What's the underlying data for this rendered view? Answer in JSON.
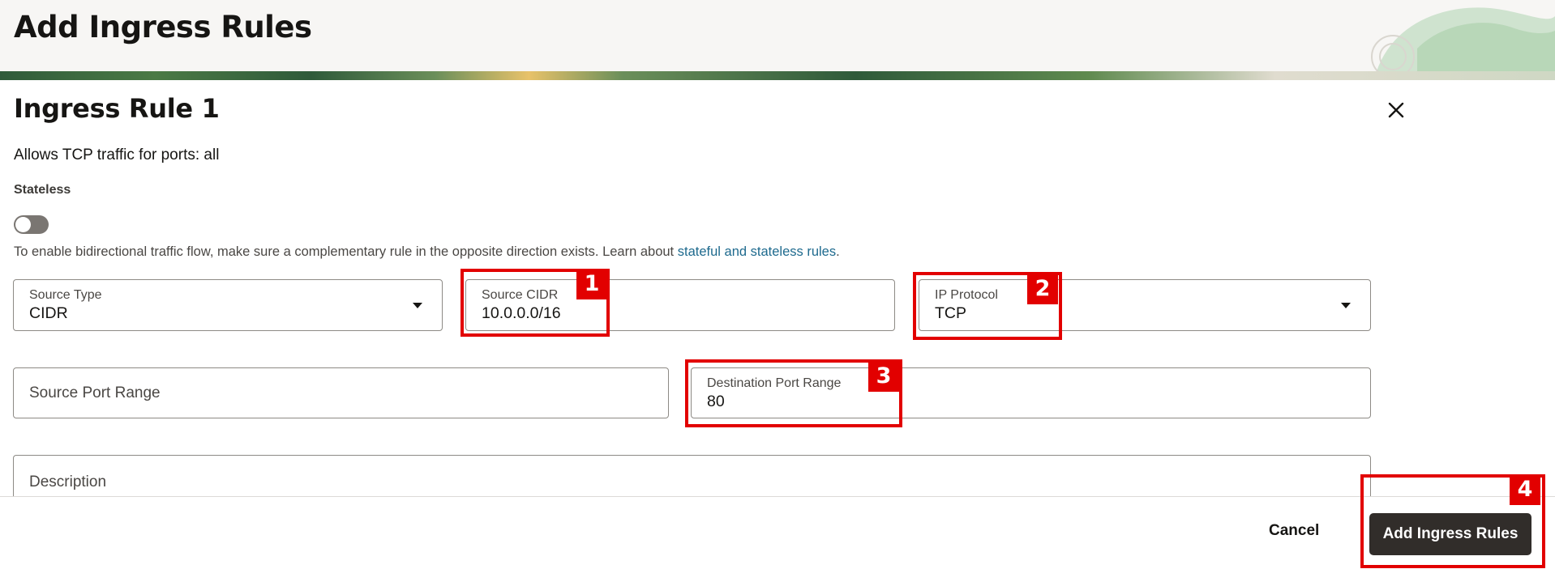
{
  "page": {
    "title": "Add Ingress Rules"
  },
  "rule": {
    "title": "Ingress Rule 1",
    "summary": "Allows TCP traffic for ports: all",
    "stateless_label": "Stateless",
    "stateless_enabled": false,
    "hint_text": "To enable bidirectional traffic flow, make sure a complementary rule in the opposite direction exists. Learn about ",
    "hint_link": "stateful and stateless rules",
    "hint_end": "."
  },
  "fields": {
    "source_type": {
      "label": "Source Type",
      "value": "CIDR"
    },
    "source_cidr": {
      "label": "Source CIDR",
      "value": "10.0.0.0/16"
    },
    "ip_protocol": {
      "label": "IP Protocol",
      "value": "TCP"
    },
    "source_port_range": {
      "placeholder": "Source Port Range"
    },
    "destination_port_range": {
      "label": "Destination Port Range",
      "value": "80"
    },
    "description": {
      "placeholder": "Description"
    }
  },
  "annotations": [
    "1",
    "2",
    "3",
    "4"
  ],
  "footer": {
    "cancel_label": "Cancel",
    "submit_label": "Add Ingress Rules"
  },
  "icons": {
    "close": "close-icon",
    "dropdown": "chevron-down-icon"
  },
  "colors": {
    "annotation": "#e20000",
    "primary_button": "#312d2a",
    "link": "#1e6a8e"
  }
}
